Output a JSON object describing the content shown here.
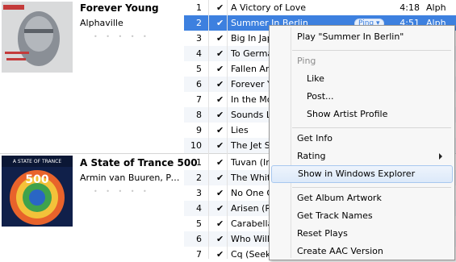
{
  "albums": [
    {
      "title": "Forever Young",
      "artist": "Alphaville",
      "rating_stars": "• • • • •",
      "cover_colors": [
        "#8a8f96",
        "#c43b3b"
      ]
    },
    {
      "title": "A State of Trance 500",
      "artist": "Armin van Buuren, Pa...",
      "rating_stars": "• • • • •",
      "cover_text": "500",
      "cover_header": "A STATE OF TRANCE"
    }
  ],
  "tracks": [
    {
      "num": "1",
      "name": "A Victory of Love",
      "time": "4:18",
      "artist": "Alph"
    },
    {
      "num": "2",
      "name": "Summer In Berlin",
      "time": "4:51",
      "artist": "Alph",
      "selected": true,
      "ping": "Ping ▾"
    },
    {
      "num": "3",
      "name": "Big In Japan",
      "time": "",
      "artist": ""
    },
    {
      "num": "4",
      "name": "To Germany with Love",
      "time": "",
      "artist": ""
    },
    {
      "num": "5",
      "name": "Fallen Angel",
      "time": "",
      "artist": ""
    },
    {
      "num": "6",
      "name": "Forever Young",
      "time": "",
      "artist": ""
    },
    {
      "num": "7",
      "name": "In the Mood",
      "time": "",
      "artist": ""
    },
    {
      "num": "8",
      "name": "Sounds Like a Melody",
      "time": "",
      "artist": ""
    },
    {
      "num": "9",
      "name": "Lies",
      "time": "",
      "artist": ""
    },
    {
      "num": "10",
      "name": "The Jet Set",
      "time": "",
      "artist": ""
    },
    {
      "num": "1",
      "name": "Tuvan (Intro)",
      "time": "",
      "artist": ""
    },
    {
      "num": "2",
      "name": "The White Stone",
      "time": "",
      "artist": ""
    },
    {
      "num": "3",
      "name": "No One On Earth",
      "time": "",
      "artist": ""
    },
    {
      "num": "4",
      "name": "Arisen (Radio Edit)",
      "time": "",
      "artist": ""
    },
    {
      "num": "5",
      "name": "Carabella",
      "time": "",
      "artist": ""
    },
    {
      "num": "6",
      "name": "Who Will Find Me",
      "time": "",
      "artist": ""
    },
    {
      "num": "7",
      "name": "Cq (Seek You)",
      "time": "",
      "artist": ""
    }
  ],
  "menu": {
    "play": "Play \"Summer In Berlin\"",
    "ping_header": "Ping",
    "like": "Like",
    "post": "Post...",
    "show_artist_profile": "Show Artist Profile",
    "get_info": "Get Info",
    "rating": "Rating",
    "show_in_explorer": "Show in Windows Explorer",
    "get_album_artwork": "Get Album Artwork",
    "get_track_names": "Get Track Names",
    "reset_plays": "Reset Plays",
    "create_aac": "Create AAC Version"
  },
  "colors": {
    "selection": "#3d80df",
    "menu_hover_border": "#a8c8ef"
  }
}
